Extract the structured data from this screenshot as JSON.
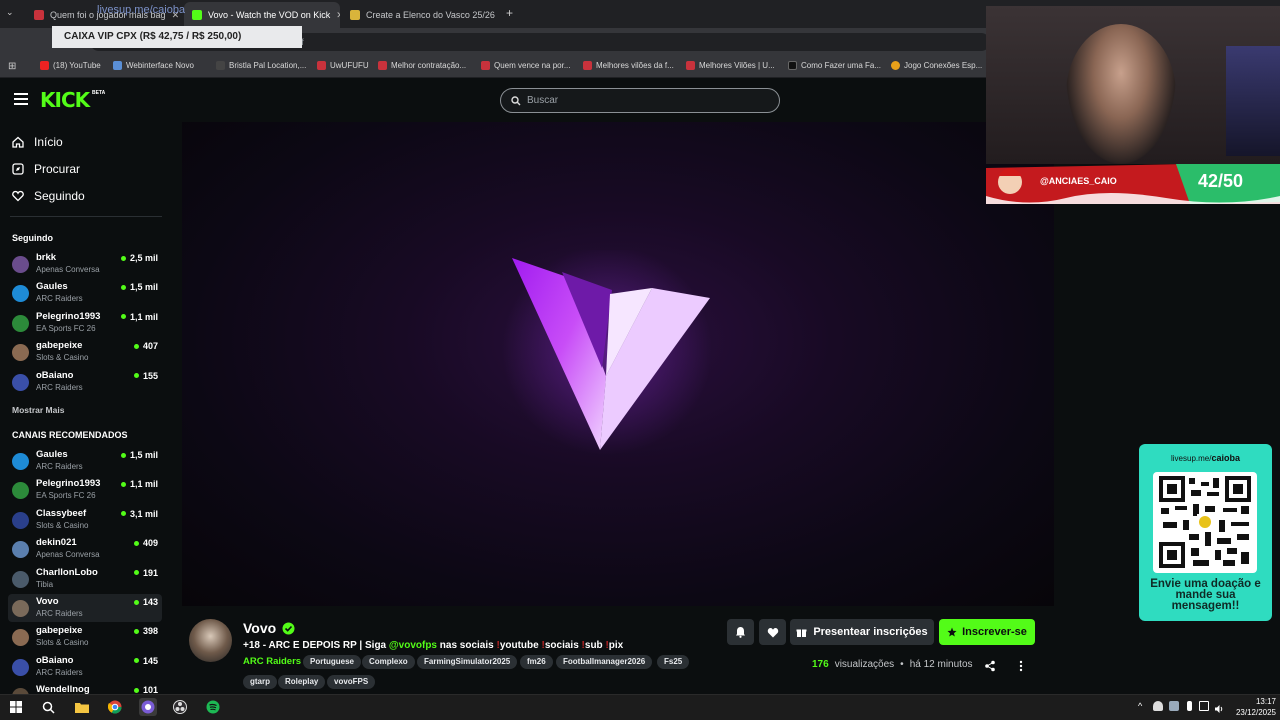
{
  "browser": {
    "tabs": [
      {
        "title": "Quem foi o jogador mais bag",
        "active": false
      },
      {
        "title": "Vovo - Watch the VOD on Kick",
        "active": true
      },
      {
        "title": "Create a Elenco do Vasco 25/26",
        "active": false
      }
    ],
    "new_tab": "+",
    "url": "kick.com/vovo/videos/...-4bd4-8ed4-72333db32ddf",
    "bookmarks": [
      "(18) YouTube",
      "Webinterface Novo",
      "Bristla Pal Location,...",
      "UwUFUFU",
      "Melhor contratação...",
      "Quem vence na por...",
      "Melhores vilões da f...",
      "Melhores Vilões | U...",
      "Como Fazer uma Fa...",
      "Jogo Conexões Esp..."
    ]
  },
  "overlay": {
    "caixa_toast": "CAIXA VIP CPX (R$ 42,75 / R$ 250,00)",
    "livesup": "livesup.me/caioba",
    "cam_handle": "@ANCIAES_CAIO",
    "cam_counter": "42/50",
    "qr_url_prefix": "livesup.me/",
    "qr_url_user": "caioba",
    "qr_message": "Envie uma doação e mande sua mensagem!!"
  },
  "kick": {
    "logo": "KICK",
    "logo_badge": "BETA",
    "search_placeholder": "Buscar",
    "nav": [
      {
        "label": "Início",
        "icon": "home-icon"
      },
      {
        "label": "Procurar",
        "icon": "compass-icon"
      },
      {
        "label": "Seguindo",
        "icon": "heart-icon"
      }
    ],
    "following_title": "Seguindo",
    "following": [
      {
        "name": "brkk",
        "category": "Apenas Conversa",
        "viewers": "2,5 mil",
        "color": "#6a4c8c"
      },
      {
        "name": "Gaules",
        "category": "ARC Raiders",
        "viewers": "1,5 mil",
        "color": "#1e8bd6"
      },
      {
        "name": "Pelegrino1993",
        "category": "EA Sports FC 26",
        "viewers": "1,1 mil",
        "color": "#2c8a3a"
      },
      {
        "name": "gabepeixe",
        "category": "Slots & Casino",
        "viewers": "407",
        "color": "#8a6a52"
      },
      {
        "name": "oBaiano",
        "category": "ARC Raiders",
        "viewers": "155",
        "color": "#3a4fa8"
      }
    ],
    "show_more": "Mostrar Mais",
    "recommended_title": "CANAIS RECOMENDADOS",
    "recommended": [
      {
        "name": "Gaules",
        "category": "ARC Raiders",
        "viewers": "1,5 mil",
        "color": "#1e8bd6"
      },
      {
        "name": "Pelegrino1993",
        "category": "EA Sports FC 26",
        "viewers": "1,1 mil",
        "color": "#2c8a3a"
      },
      {
        "name": "Classybeef",
        "category": "Slots & Casino",
        "viewers": "3,1 mil",
        "color": "#2a3f8a"
      },
      {
        "name": "dekin021",
        "category": "Apenas Conversa",
        "viewers": "409",
        "color": "#5b7fae"
      },
      {
        "name": "CharllonLobo",
        "category": "Tibia",
        "viewers": "191",
        "color": "#4a5a6a"
      },
      {
        "name": "Vovo",
        "category": "ARC Raiders",
        "viewers": "143",
        "color": "#7a6a5a"
      },
      {
        "name": "gabepeixe",
        "category": "Slots & Casino",
        "viewers": "398",
        "color": "#8a6a52"
      },
      {
        "name": "oBaiano",
        "category": "ARC Raiders",
        "viewers": "145",
        "color": "#3a4fa8"
      },
      {
        "name": "Wendellnog",
        "category": "",
        "viewers": "101",
        "color": "#5a4a3a"
      }
    ],
    "selected_channel": "Vovo"
  },
  "stream": {
    "streamer": "Vovo",
    "title_pre": "+18 - ARC E DEPOIS RP | Siga ",
    "title_handle": "@vovofps",
    "title_mid": " nas sociais ",
    "title_parts": [
      "youtube",
      "sociais",
      "sub",
      "pix"
    ],
    "category": "ARC Raiders",
    "tags": [
      "Portuguese",
      "Complexo",
      "FarmingSimulator2025",
      "fm26",
      "Footballmanager2026",
      "Fs25",
      "gtarp",
      "Roleplay",
      "vovoFPS"
    ],
    "gift_label": "Presentear inscrições",
    "subscribe_label": "Inscrever-se",
    "views_count": "176",
    "views_label": "visualizações",
    "dot": "•",
    "time_ago": "há 12 minutos",
    "accent": "#53fc18"
  },
  "taskbar": {
    "time": "13:17",
    "date": "23/12/2025"
  }
}
